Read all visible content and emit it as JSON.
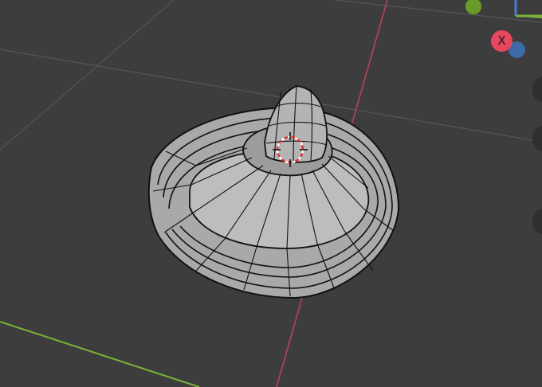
{
  "viewport": {
    "background": "#3d3d3d",
    "object": "hat-mesh",
    "mode": "wireframe-overlay"
  },
  "axes": {
    "x_axis_color": "#c2455a",
    "y_axis_color": "#7ab23a",
    "grid_color": "#5a5a5a"
  },
  "gizmo": {
    "x_label": "X",
    "x_color": "#e8475f",
    "y_color": "#6a9a2a",
    "z_color": "#3f69a8"
  },
  "cursor": {
    "icon": "3d-cursor-icon",
    "colors": [
      "#e03030",
      "#ffffff"
    ]
  }
}
